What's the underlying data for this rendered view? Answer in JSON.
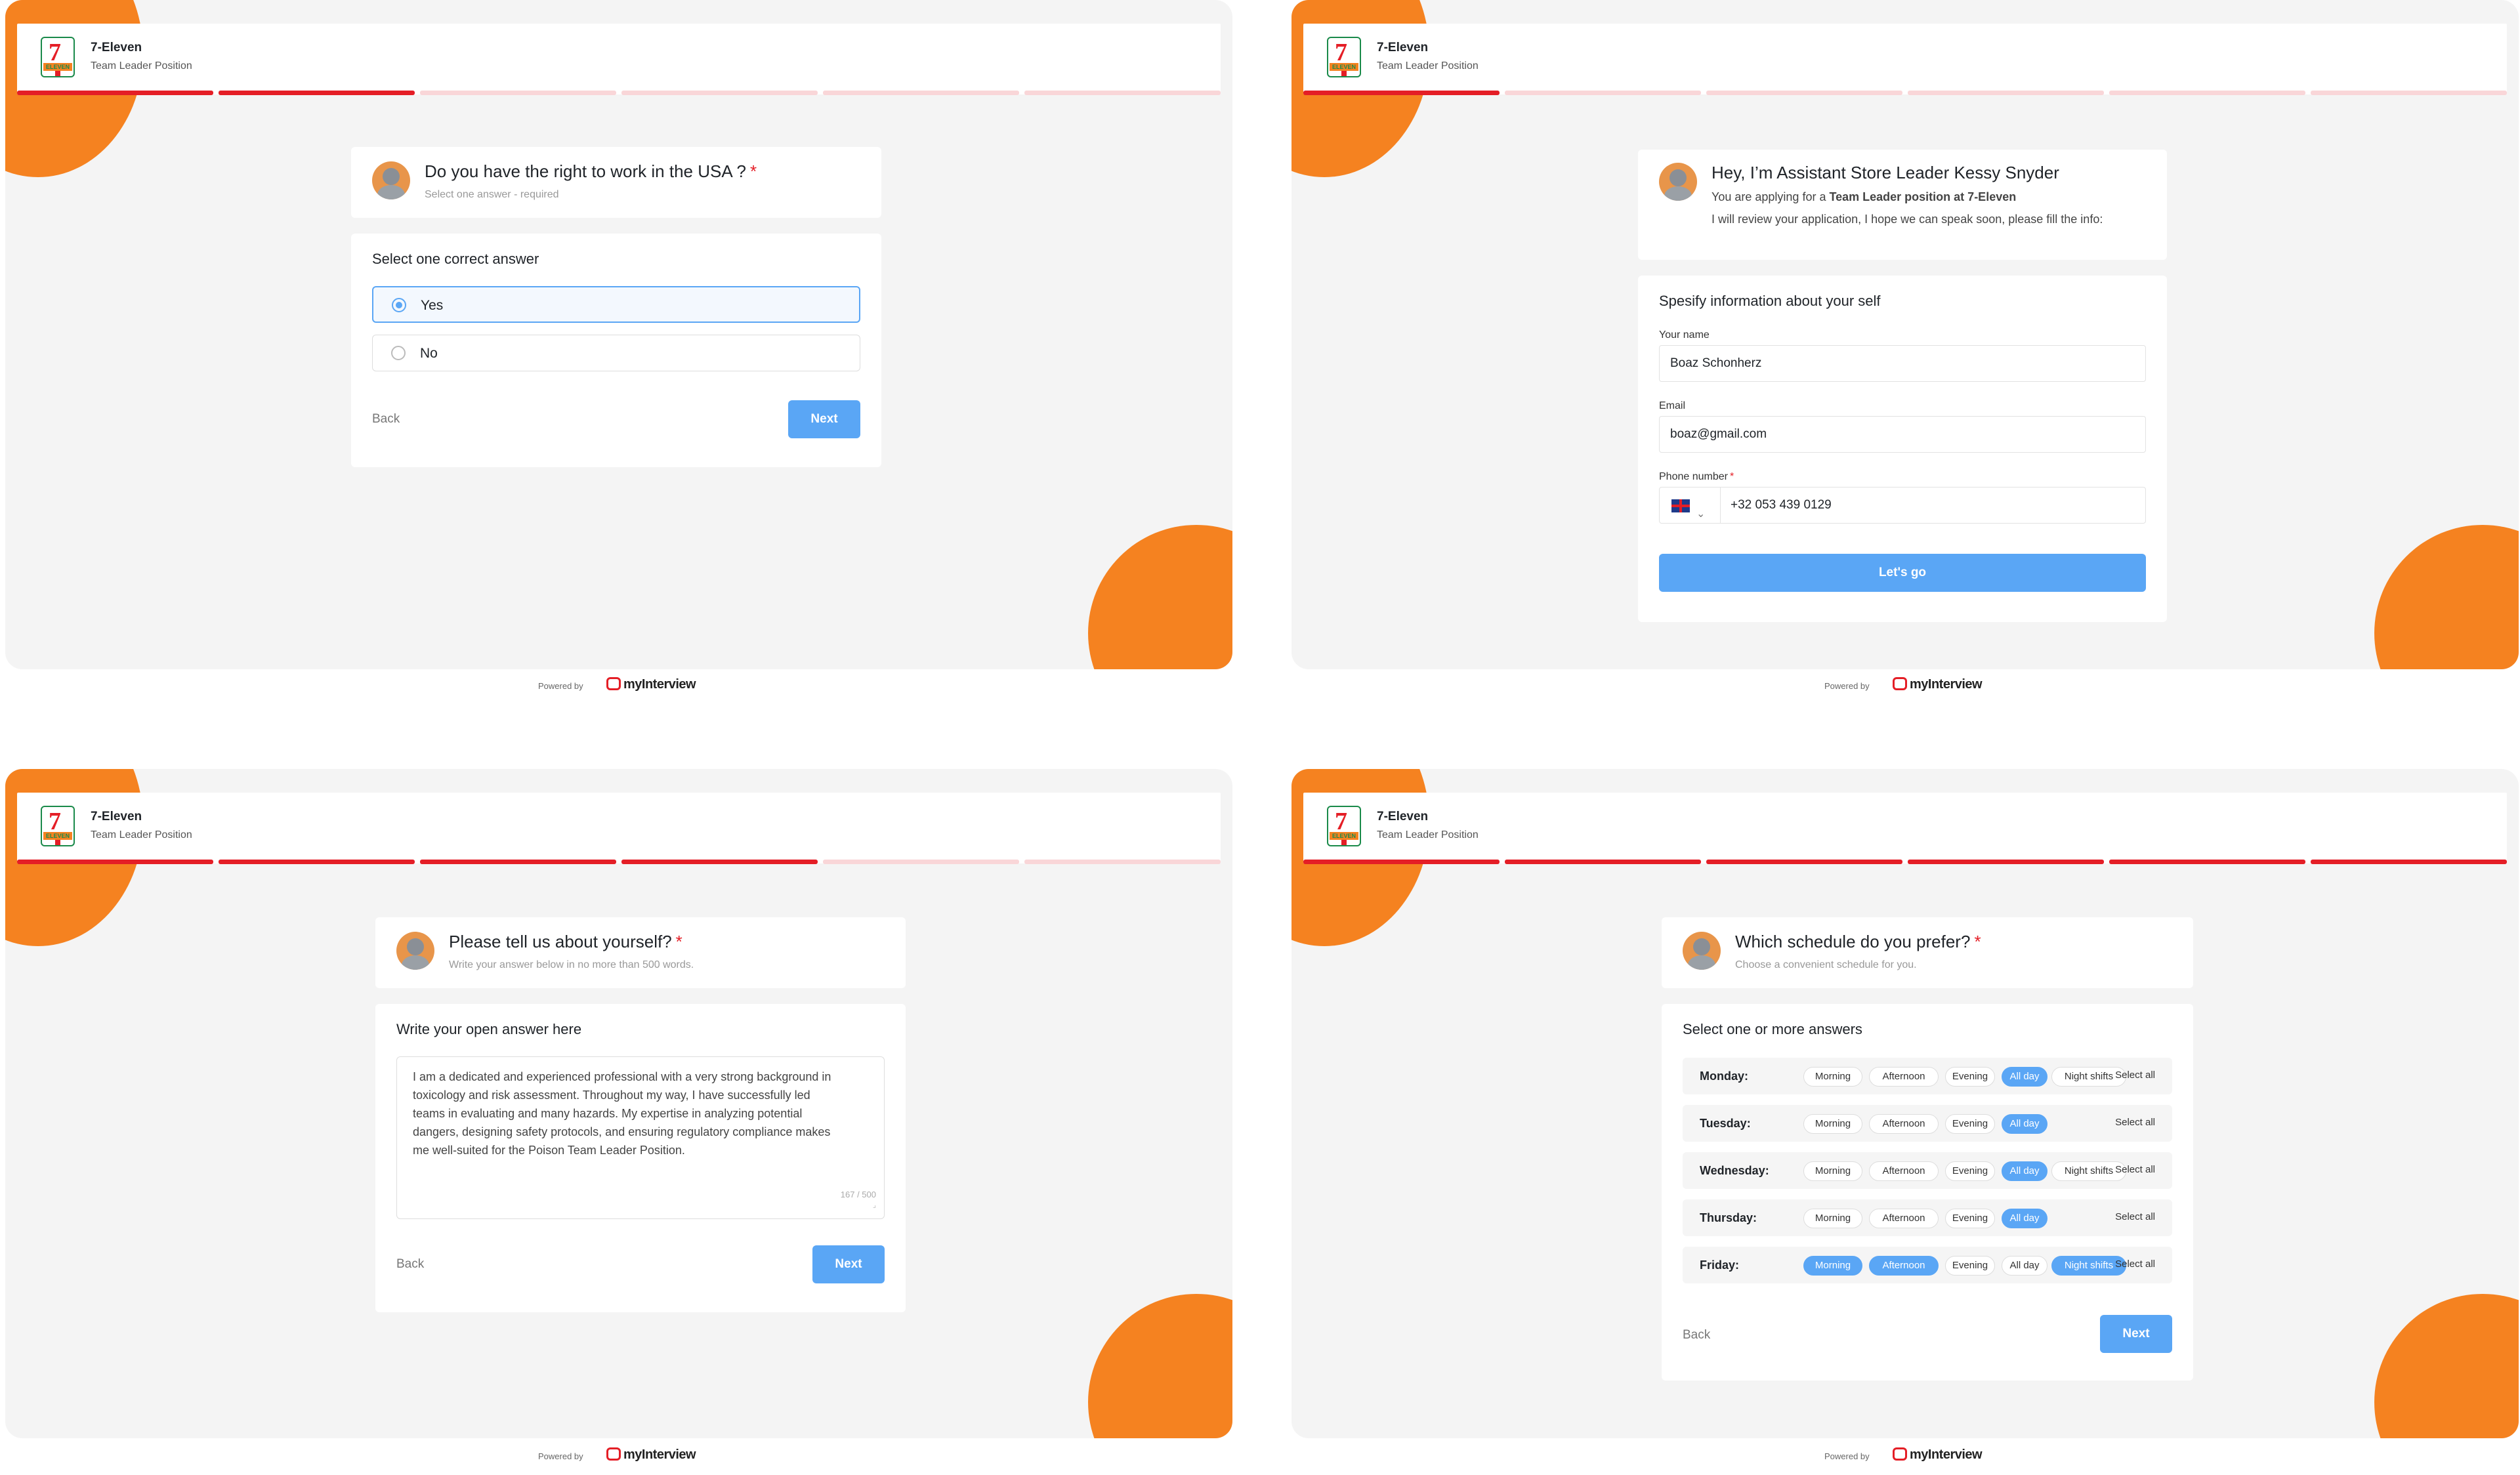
{
  "brand": {
    "name": "7-Eleven",
    "position": "Team Leader Position",
    "logo_text": "7",
    "logo_sub": "ELEVEN"
  },
  "colors": {
    "accent_blue": "#5aa6f5",
    "brand_red": "#e41e26",
    "brand_orange": "#f58220"
  },
  "footer": {
    "powered_by": "Powered by",
    "provider": "myInterview"
  },
  "screens": [
    {
      "progress": [
        true,
        true,
        false,
        false,
        false,
        false
      ],
      "question": {
        "title": "Do you have the right to work in the USA ?",
        "required_mark": "*",
        "subtitle": "Select one answer - required"
      },
      "section_title": "Select one correct answer",
      "options": [
        {
          "label": "Yes",
          "selected": true
        },
        {
          "label": "No",
          "selected": false
        }
      ],
      "back_label": "Back",
      "next_label": "Next"
    },
    {
      "progress": [
        true,
        false,
        false,
        false,
        false,
        false
      ],
      "intro": {
        "title": "Hey, I’m Assistant Store Leader Kessy Snyder",
        "line1_prefix": "You are applying for a ",
        "line1_bold": "Team Leader position at 7-Eleven",
        "line2": "I will review your application, I hope we can speak soon, please fill the info:"
      },
      "section_title": "Spesify information about your self",
      "fields": {
        "name_label": "Your name",
        "name_value": "Boaz Schonherz",
        "email_label": "Email",
        "email_value": "boaz@gmail.com",
        "phone_label": "Phone number",
        "phone_required": "*",
        "phone_value": "+32 053 439 0129",
        "country_flag": "uk-flag-icon"
      },
      "submit_label": "Let's go"
    },
    {
      "progress": [
        true,
        true,
        true,
        true,
        false,
        false
      ],
      "question": {
        "title": "Please tell us about yourself?",
        "required_mark": "*",
        "subtitle": "Write your answer below in no more than 500 words."
      },
      "section_title": "Write your open answer here",
      "answer": "I am a dedicated and experienced professional with a very strong background in toxicology and risk assessment. Throughout my way, I have successfully led teams in evaluating and many hazards. My expertise in analyzing potential dangers, designing safety protocols, and ensuring regulatory compliance makes me well-suited for the Poison Team Leader Position.",
      "counter": "167 / 500",
      "back_label": "Back",
      "next_label": "Next"
    },
    {
      "progress": [
        true,
        true,
        true,
        true,
        true,
        true
      ],
      "question": {
        "title": "Which schedule do you prefer?",
        "required_mark": "*",
        "subtitle": "Choose a convenient schedule for you."
      },
      "section_title": "Select one or more answers",
      "select_all_label": "Select all",
      "rows": [
        {
          "day": "Monday:",
          "pills": [
            {
              "label": "Morning",
              "on": false
            },
            {
              "label": "Afternoon",
              "on": false
            },
            {
              "label": "Evening",
              "on": false
            },
            {
              "label": "All day",
              "on": true
            },
            {
              "label": "Night shifts",
              "on": false
            }
          ]
        },
        {
          "day": "Tuesday:",
          "pills": [
            {
              "label": "Morning",
              "on": false
            },
            {
              "label": "Afternoon",
              "on": false
            },
            {
              "label": "Evening",
              "on": false
            },
            {
              "label": "All day",
              "on": true
            }
          ]
        },
        {
          "day": "Wednesday:",
          "pills": [
            {
              "label": "Morning",
              "on": false
            },
            {
              "label": "Afternoon",
              "on": false
            },
            {
              "label": "Evening",
              "on": false
            },
            {
              "label": "All day",
              "on": true
            },
            {
              "label": "Night shifts",
              "on": false
            }
          ]
        },
        {
          "day": "Thursday:",
          "pills": [
            {
              "label": "Morning",
              "on": false
            },
            {
              "label": "Afternoon",
              "on": false
            },
            {
              "label": "Evening",
              "on": false
            },
            {
              "label": "All day",
              "on": true
            }
          ]
        },
        {
          "day": "Friday:",
          "pills": [
            {
              "label": "Morning",
              "on": true
            },
            {
              "label": "Afternoon",
              "on": true
            },
            {
              "label": "Evening",
              "on": false
            },
            {
              "label": "All day",
              "on": false
            },
            {
              "label": "Night shifts",
              "on": true
            }
          ]
        }
      ],
      "back_label": "Back",
      "next_label": "Next"
    }
  ]
}
